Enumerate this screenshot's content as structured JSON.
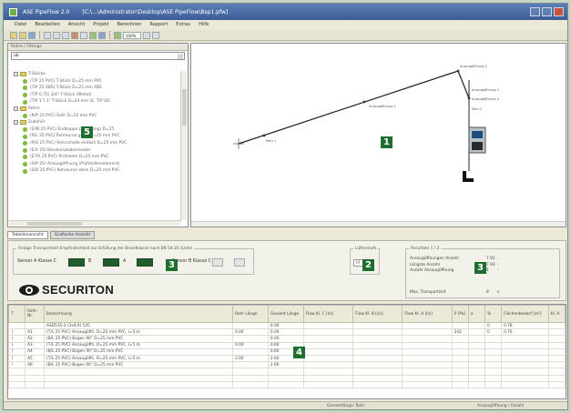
{
  "window": {
    "app_title": "ASE PipeFlow 2.0",
    "doc_title": "[C:\\...\\Administrator\\Desktop\\ASE PipeFlow\\Bsp1.pfw]"
  },
  "menu": [
    "Datei",
    "Bearbeiten",
    "Ansicht",
    "Projekt",
    "Berechnen",
    "Rapport",
    "Extras",
    "Hilfe"
  ],
  "toolbar": {
    "zoom_value": "100%"
  },
  "left_panel": {
    "header": "Rohre / Fittings",
    "select_value": "ab",
    "tree": [
      {
        "level": 0,
        "label": "T-Stücke",
        "expand": "−"
      },
      {
        "level": 1,
        "label": "(T/P 25 PVC) T-Stück D=25 mm PVC"
      },
      {
        "level": 1,
        "label": "(T/P 25 ABS) T-Stück D=25 mm ABS"
      },
      {
        "level": 1,
        "label": "(T/P 0.75) 3/4\" T-Stück (Metall)"
      },
      {
        "level": 1,
        "label": "(T/P 1\") 1\" T-Stück D=24 mm (E, T/P SE)"
      },
      {
        "level": 0,
        "label": "Rohre",
        "expand": "−"
      },
      {
        "level": 1,
        "label": "(R/P 25 PVC) Rohr D=25 mm PVC"
      },
      {
        "level": 0,
        "label": "Zubehör",
        "expand": "−"
      },
      {
        "level": 1,
        "label": "(E/W 25 PVC) Endkappe (Zuleitung) D=25"
      },
      {
        "level": 1,
        "label": "(R/L 25 PVC) Rohrkurve gross D=25 mm PVC"
      },
      {
        "level": 1,
        "label": "(R/S 25 PVC) Rohrschelle einfach D=25 mm PVC"
      },
      {
        "level": 1,
        "label": "(E/V 25) Kondensatabscheider"
      },
      {
        "level": 1,
        "label": "(E/Th 25 PVC) Prüfstelle D=25 mm PVC"
      },
      {
        "level": 1,
        "label": "(A/P 25) Ansaugöffnung (Prüfstellenelement)"
      },
      {
        "level": 1,
        "label": "(S/D 25 PVC) Rohrkurve eben D=25 mm PVC"
      }
    ]
  },
  "canvas": {
    "labels": [
      "Ansaugöffnung 1",
      "Ansaugöffnung 2",
      "Ansaugöffnung 3",
      "Ansaugöffnung 4",
      "Rohr 1",
      "Rohr 2"
    ]
  },
  "tabs": [
    {
      "label": "Tabellenansicht",
      "active": true
    },
    {
      "label": "Grafische Ansicht",
      "active": false
    }
  ],
  "settings": {
    "group1_label": "Anlage Transportzeit Empfindlichkeit zur Erfüllung der Brandklasse nach EN 54-20 (Liste)",
    "sensor_a_label": "Sensor A Klasse C",
    "sep_b": "B",
    "sep_a": "A",
    "sensor_b_label": "Sensor B Klasse C",
    "group2_label": "Lüfterstufe",
    "fan_value": "III",
    "group3_label": "Resultate 1 / 3",
    "results": [
      {
        "label": "Ansaugöffnungen Anzahl",
        "value": "7.92",
        "unit": "-"
      },
      {
        "label": "Längste Anzahl",
        "value": "7.93",
        "unit": "-"
      },
      {
        "label": "Anzahl Ansaugöffnung",
        "value": "4",
        "unit": "-"
      },
      {
        "label": "Max. Transportzeit",
        "value": "8",
        "unit": "s"
      }
    ],
    "logo": "SECURITON"
  },
  "table": {
    "headers": [
      "T",
      "Rohr-Nr.",
      "Bezeichnung",
      "Rohr Länge",
      "Gesamt Länge",
      "Flow Kl. C [l/s]",
      "Flow Kl. B [l/s]",
      "Flow Kl. A [l/s]",
      "P [Pa]",
      "a",
      "%",
      "Flächenbedarf [m²]",
      "Kl. A"
    ],
    "rows": [
      {
        "tree": "",
        "nr": "",
        "name": "ASD535-2 (3x4.6) 535",
        "len": "",
        "total": "0.00",
        "c": "",
        "b": "",
        "a": "",
        "p": "",
        "aa": "",
        "pct": "0",
        "area": "0.78",
        "kl": ""
      },
      {
        "tree": "├",
        "nr": "A1",
        "name": "(T/L 25 PVC) Ansaugöffn. D=25 mm PVC, l=5 m",
        "len": "0.00",
        "total": "0.00",
        "c": "",
        "b": "",
        "a": "",
        "p": "242",
        "aa": "",
        "pct": "0",
        "area": "0.76",
        "kl": ""
      },
      {
        "tree": "├",
        "nr": "A2",
        "name": "(B/L 25 PVC) Bogen 90° D=25 mm PVC",
        "len": "",
        "total": "0.00",
        "c": "",
        "b": "",
        "a": "",
        "p": "",
        "aa": "",
        "pct": "",
        "area": "",
        "kl": ""
      },
      {
        "tree": "├",
        "nr": "A3",
        "name": "(T/L 25 PVC) Ansaugöffn. D=25 mm PVC, l=5 m",
        "len": "0.00",
        "total": "0.60",
        "c": "",
        "b": "",
        "a": "",
        "p": "",
        "aa": "",
        "pct": "",
        "area": "",
        "kl": ""
      },
      {
        "tree": "├",
        "nr": "A4",
        "name": "(B/L 25 PVC) Bogen 90° D=25 mm PVC",
        "len": "",
        "total": "0.60",
        "c": "",
        "b": "",
        "a": "",
        "p": "",
        "aa": "",
        "pct": "",
        "area": "",
        "kl": ""
      },
      {
        "tree": "├",
        "nr": "A5",
        "name": "(T/L 25 PVC) Ansaugöffn. D=25 mm PVC, l=5 m",
        "len": "2.00",
        "total": "2.60",
        "c": "",
        "b": "",
        "a": "",
        "p": "",
        "aa": "",
        "pct": "",
        "area": "",
        "kl": ""
      },
      {
        "tree": "└",
        "nr": "A6",
        "name": "(B/L 25 PVC) Bogen 90° D=25 mm PVC",
        "len": "",
        "total": "2.60",
        "c": "",
        "b": "",
        "a": "",
        "p": "",
        "aa": "",
        "pct": "",
        "area": "",
        "kl": ""
      }
    ]
  },
  "status": {
    "left": "",
    "mid": "Gesamtlänge: Rohr",
    "right": "Ansaugöffnung / Anzahl"
  },
  "markers": [
    "1",
    "2",
    "3",
    "3",
    "4",
    "5"
  ]
}
